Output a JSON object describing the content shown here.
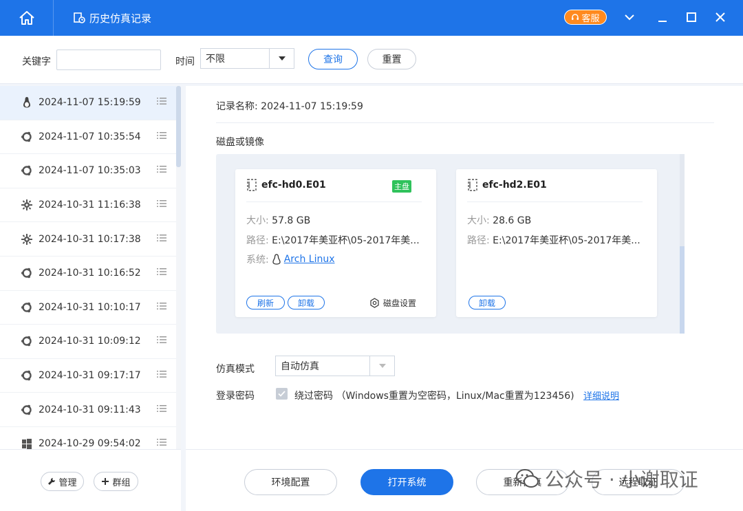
{
  "titlebar": {
    "title": "历史仿真记录",
    "service_label": "客服",
    "accent_color": "#1e74e8",
    "service_color": "#ff8a1f"
  },
  "search": {
    "keyword_label": "关键字",
    "keyword_value": "",
    "time_label": "时间",
    "time_value": "不限",
    "query_label": "查询",
    "reset_label": "重置"
  },
  "records": [
    {
      "time": "2024-11-07 15:19:59",
      "os_icon": "linux-icon"
    },
    {
      "time": "2024-11-07 10:35:54",
      "os_icon": "ubuntu-icon"
    },
    {
      "time": "2024-11-07 10:35:03",
      "os_icon": "ubuntu-icon"
    },
    {
      "time": "2024-10-31 11:16:38",
      "os_icon": "gear-os-icon"
    },
    {
      "time": "2024-10-31 10:17:38",
      "os_icon": "gear-os-icon"
    },
    {
      "time": "2024-10-31 10:16:52",
      "os_icon": "ubuntu-icon"
    },
    {
      "time": "2024-10-31 10:10:17",
      "os_icon": "ubuntu-icon"
    },
    {
      "time": "2024-10-31 10:09:12",
      "os_icon": "ubuntu-icon"
    },
    {
      "time": "2024-10-31 09:17:17",
      "os_icon": "ubuntu-icon"
    },
    {
      "time": "2024-10-31 09:11:43",
      "os_icon": "ubuntu-icon"
    },
    {
      "time": "2024-10-29 09:54:02",
      "os_icon": "windows-icon"
    }
  ],
  "sidebar_footer": {
    "manage_label": "管理",
    "group_label": "群组"
  },
  "detail": {
    "record_name_label": "记录名称:",
    "record_name_value": "2024-11-07 15:19:59",
    "disk_section_title": "磁盘或镜像",
    "disks": [
      {
        "name": "efc-hd0.E01",
        "badge": "主盘",
        "size_label": "大小:",
        "size_value": "57.8 GB",
        "path_label": "路径:",
        "path_value": "E:\\2017年美亚杯\\05-2017年美...",
        "system_label": "系统:",
        "system_value": "Arch Linux",
        "refresh_label": "刷新",
        "unmount_label": "卸载",
        "settings_label": "磁盘设置"
      },
      {
        "name": "efc-hd2.E01",
        "size_label": "大小:",
        "size_value": "28.6 GB",
        "path_label": "路径:",
        "path_value": "E:\\2017年美亚杯\\05-2017年美...",
        "unmount_label": "卸载"
      }
    ],
    "mode_label": "仿真模式",
    "mode_value": "自动仿真",
    "password_label": "登录密码",
    "password_checked": true,
    "password_option": "绕过密码 （Windows重置为空密码，Linux/Mac重置为123456)",
    "password_link": "详细说明"
  },
  "actions": {
    "env_config": "环境配置",
    "open_system": "打开系统",
    "re_emulate": "重新仿真",
    "remote_forensics": "远程取证"
  },
  "watermark": {
    "text": "公众号 · 小谢取证"
  }
}
